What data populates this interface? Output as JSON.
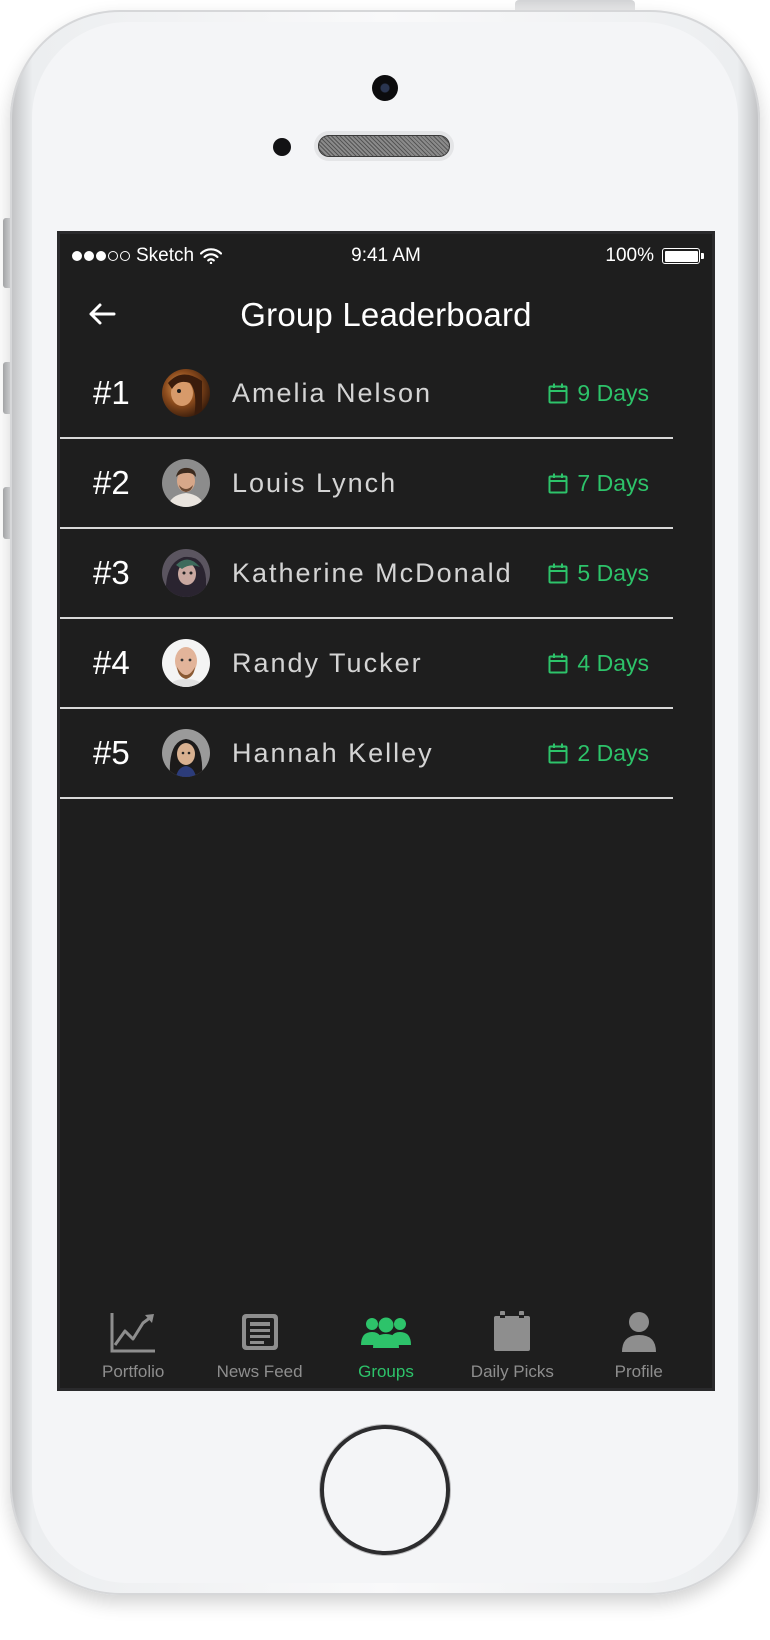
{
  "status_bar": {
    "carrier": "Sketch",
    "time": "9:41 AM",
    "battery": "100%"
  },
  "nav": {
    "title": "Group Leaderboard",
    "back_icon": "arrow-left-icon"
  },
  "leaderboard": [
    {
      "rank": "#1",
      "name": "Amelia Nelson",
      "days": "9 Days"
    },
    {
      "rank": "#2",
      "name": "Louis Lynch",
      "days": "7 Days"
    },
    {
      "rank": "#3",
      "name": "Katherine McDonald",
      "days": "5 Days"
    },
    {
      "rank": "#4",
      "name": "Randy Tucker",
      "days": "4 Days"
    },
    {
      "rank": "#5",
      "name": "Hannah Kelley",
      "days": "2 Days"
    }
  ],
  "tabs": [
    {
      "label": "Portfolio",
      "icon": "chart-icon",
      "active": false
    },
    {
      "label": "News Feed",
      "icon": "newspaper-icon",
      "active": false
    },
    {
      "label": "Groups",
      "icon": "group-icon",
      "active": true
    },
    {
      "label": "Daily Picks",
      "icon": "calendar-icon",
      "active": false
    },
    {
      "label": "Profile",
      "icon": "person-icon",
      "active": false
    }
  ],
  "colors": {
    "accent": "#2dc36a",
    "screen_background": "#1e1e1e",
    "inactive_tab": "#8e8e8e"
  }
}
